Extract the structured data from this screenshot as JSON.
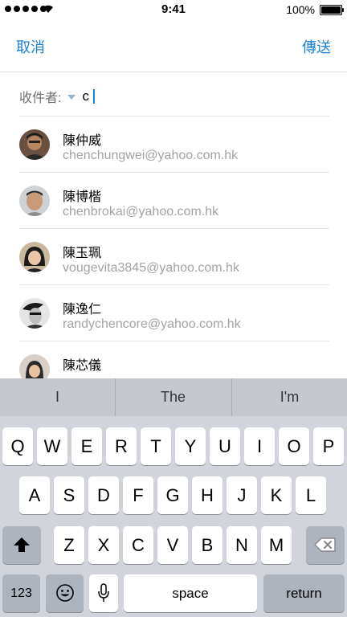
{
  "status_bar": {
    "time": "9:41",
    "battery": "100%"
  },
  "nav": {
    "cancel": "取消",
    "send": "傳送"
  },
  "recipient": {
    "label": "收件者:",
    "value": "c"
  },
  "suggestions": [
    {
      "name": "陳仲威",
      "email": "chenchungwei@yahoo.com.hk"
    },
    {
      "name": "陳博楷",
      "email": "chenbrokai@yahoo.com.hk"
    },
    {
      "name": "陳玉珮",
      "email": "vougevita3845@yahoo.com.hk"
    },
    {
      "name": "陳逸仁",
      "email": "randychencore@yahoo.com.hk"
    },
    {
      "name": "陳芯儀",
      "email": ""
    }
  ],
  "keyboard": {
    "predictions": [
      "I",
      "The",
      "I'm"
    ],
    "row1": [
      "Q",
      "W",
      "E",
      "R",
      "T",
      "Y",
      "U",
      "I",
      "O",
      "P"
    ],
    "row2": [
      "A",
      "S",
      "D",
      "F",
      "G",
      "H",
      "J",
      "K",
      "L"
    ],
    "row3": [
      "Z",
      "X",
      "C",
      "V",
      "B",
      "N",
      "M"
    ],
    "numbers": "123",
    "space": "space",
    "return": "return"
  }
}
